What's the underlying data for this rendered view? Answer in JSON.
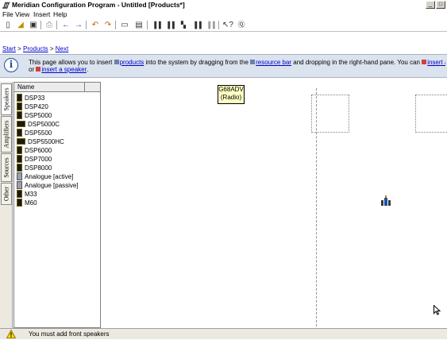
{
  "window": {
    "title": "Meridian Configuration Program - Untitled [Products*]",
    "minimize": "_",
    "maximize": "□"
  },
  "menu": [
    {
      "label": "File"
    },
    {
      "label": "View"
    },
    {
      "label": "Insert"
    },
    {
      "label": "Help"
    }
  ],
  "breadcrumb": {
    "start": "Start",
    "products": "Products",
    "next": "Next",
    "separator": ">"
  },
  "info": {
    "t1": "This page allows you to insert ",
    "products_link": "products",
    "t2": " into the system by dragging from the ",
    "resource_link": "resource bar",
    "t3": " and dropping in the right-hand pane. You can ",
    "source_link": "insert a source",
    "t4": "or ",
    "speaker_link": "insert a speaker",
    "t5": "."
  },
  "tabs": [
    {
      "label": "Speakers",
      "active": true
    },
    {
      "label": "Amplifiers",
      "active": false
    },
    {
      "label": "Sources",
      "active": false
    },
    {
      "label": "Other",
      "active": false
    }
  ],
  "list": {
    "header": "Name",
    "items": [
      {
        "name": "DSP33",
        "icon": "speaker-icon"
      },
      {
        "name": "DSP420",
        "icon": "speaker-icon"
      },
      {
        "name": "DSP5000",
        "icon": "speaker-icon"
      },
      {
        "name": "DSP5000C",
        "icon": "center-speaker-icon"
      },
      {
        "name": "DSP5500",
        "icon": "speaker-icon"
      },
      {
        "name": "DSP5500HC",
        "icon": "center-speaker-icon"
      },
      {
        "name": "DSP6000",
        "icon": "speaker-icon"
      },
      {
        "name": "DSP7000",
        "icon": "speaker-icon"
      },
      {
        "name": "DSP8000",
        "icon": "speaker-icon"
      },
      {
        "name": "Analogue [active]",
        "icon": "analogue-speaker-icon"
      },
      {
        "name": "Analogue [passive]",
        "icon": "analogue-speaker-icon"
      },
      {
        "name": "M33",
        "icon": "speaker-icon"
      },
      {
        "name": "M60",
        "icon": "speaker-icon"
      }
    ]
  },
  "canvas": {
    "tooltip_line1": "G68ADV",
    "tooltip_line2": "(Radio)"
  },
  "status": {
    "message": "You must add front speakers"
  },
  "colors": {
    "link": "#0000cc",
    "info_bg": "#dbe3ee",
    "tooltip_bg": "#ffffc4"
  }
}
